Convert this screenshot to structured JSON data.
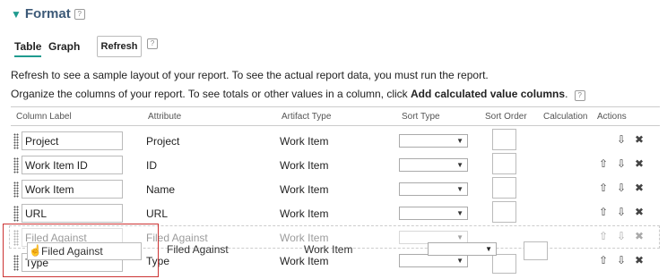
{
  "section": {
    "title": "Format",
    "help": "?"
  },
  "tabs": [
    {
      "label": "Table"
    },
    {
      "label": "Graph"
    }
  ],
  "refresh_label": "Refresh",
  "info": {
    "line1": "Refresh to see a sample layout of your report. To see the actual report data, you must run the report.",
    "line2_prefix": "Organize the columns of your report. To see totals or other values in a column, click ",
    "line2_bold": "Add calculated value columns",
    "line2_suffix": "."
  },
  "headers": {
    "column_label": "Column Label",
    "attribute": "Attribute",
    "artifact_type": "Artifact Type",
    "sort_type": "Sort Type",
    "sort_order": "Sort Order",
    "calculation": "Calculation",
    "actions": "Actions"
  },
  "rows": [
    {
      "label": "Project",
      "attribute": "Project",
      "artifact": "Work Item"
    },
    {
      "label": "Work Item ID",
      "attribute": "ID",
      "artifact": "Work Item"
    },
    {
      "label": "Work Item",
      "attribute": "Name",
      "artifact": "Work Item"
    },
    {
      "label": "URL",
      "attribute": "URL",
      "artifact": "Work Item"
    },
    {
      "label": "Filed Against",
      "attribute": "Filed Against",
      "artifact": "Work Item"
    },
    {
      "label": "Type",
      "attribute": "Type",
      "artifact": "Work Item"
    }
  ],
  "drag": {
    "label": "Filed Against",
    "attribute": "Filed Against",
    "artifact": "Work Item"
  },
  "icons": {
    "up": "arrow-up-icon",
    "down": "arrow-down-icon",
    "remove": "remove-icon",
    "grip": "drag-handle-icon"
  },
  "colors": {
    "title": "#3d5a78",
    "accent": "#1f9b8f",
    "drag_outline": "#cc3333"
  }
}
